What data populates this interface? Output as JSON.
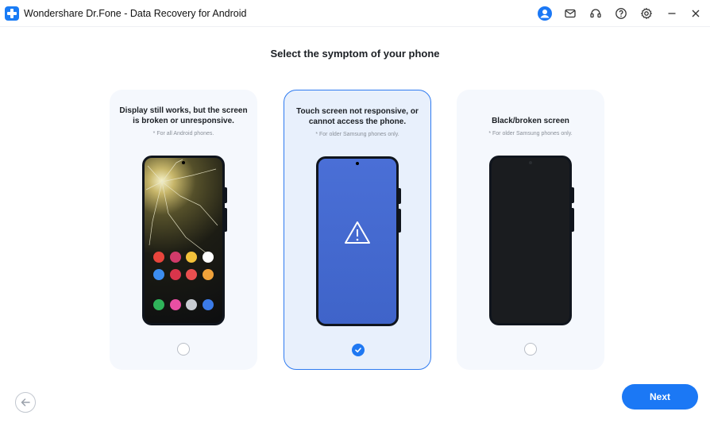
{
  "window": {
    "title": "Wondershare Dr.Fone - Data Recovery for Android",
    "icons": [
      "account-icon",
      "mail-icon",
      "headset-icon",
      "help-icon",
      "settings-icon",
      "minimize-icon",
      "close-icon"
    ]
  },
  "page": {
    "heading": "Select the symptom of your phone"
  },
  "options": [
    {
      "title": "Display still works, but the screen is broken or unresponsive.",
      "note": "* For all Android phones.",
      "selected": false
    },
    {
      "title": "Touch screen not responsive, or cannot access the phone.",
      "note": "* For older Samsung phones only.",
      "selected": true
    },
    {
      "title": "Black/broken screen",
      "note": "* For older Samsung phones only.",
      "selected": false
    }
  ],
  "footer": {
    "next_label": "Next"
  },
  "colors": {
    "accent": "#1b78f5",
    "card_bg": "#f5f8fd",
    "selected_bg": "#e8f0fc"
  }
}
